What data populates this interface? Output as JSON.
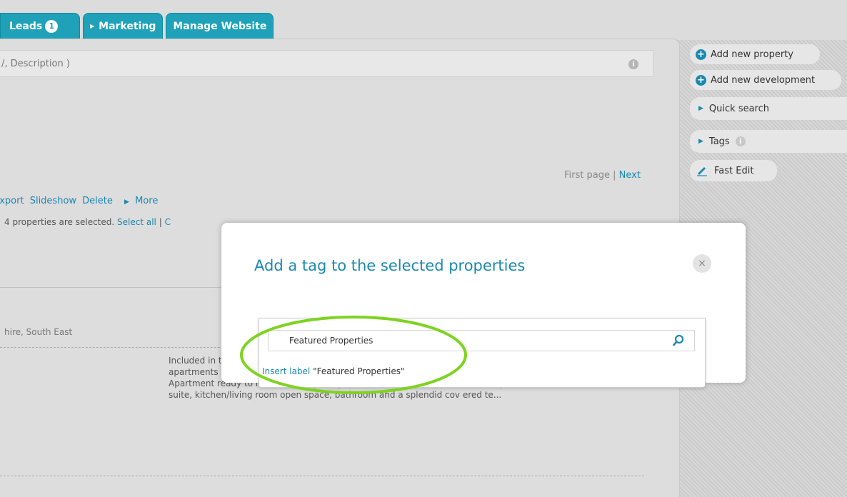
{
  "tabs": [
    {
      "label": "Leads",
      "badge": "1"
    },
    {
      "label": "Marketing",
      "arrow": "▶"
    },
    {
      "label": "Manage Website"
    }
  ],
  "main": {
    "search_placeholder": "/, Description )",
    "pager": {
      "first": "First page",
      "sep": " | ",
      "next": "Next"
    },
    "actions": {
      "export": "Export",
      "slideshow": "Slideshow",
      "delete": "Delete",
      "more": "More"
    },
    "selection": {
      "text": "4 properties are selected.",
      "select_all": "Select all",
      "sep": " | ",
      "clear": "C"
    },
    "location": "hire, South East",
    "description": "Included in the \"Sapphire Tower\", now anyone has the possibility of renting one of the most luxurious apartments of the city.\nApartment ready to move in, completely furnished, where the 45m2 are complete with a beautiful bedroom suite, kitchen/living room open space, bathroom and a splendid cov ered te..."
  },
  "sidebar": {
    "add_property": "Add new property",
    "add_development": "Add new development",
    "quick_search": "Quick search",
    "tags": "Tags",
    "fast_edit": "Fast Edit"
  },
  "modal": {
    "title": "Add a tag to the selected properties",
    "close": "×",
    "input_value": "Featured Properties",
    "insert_link": "Insert label",
    "insert_value": " \"Featured Properties\""
  },
  "colors": {
    "accent": "#1a88b0",
    "tab": "#1fa2b9",
    "highlight": "#7ed321"
  }
}
